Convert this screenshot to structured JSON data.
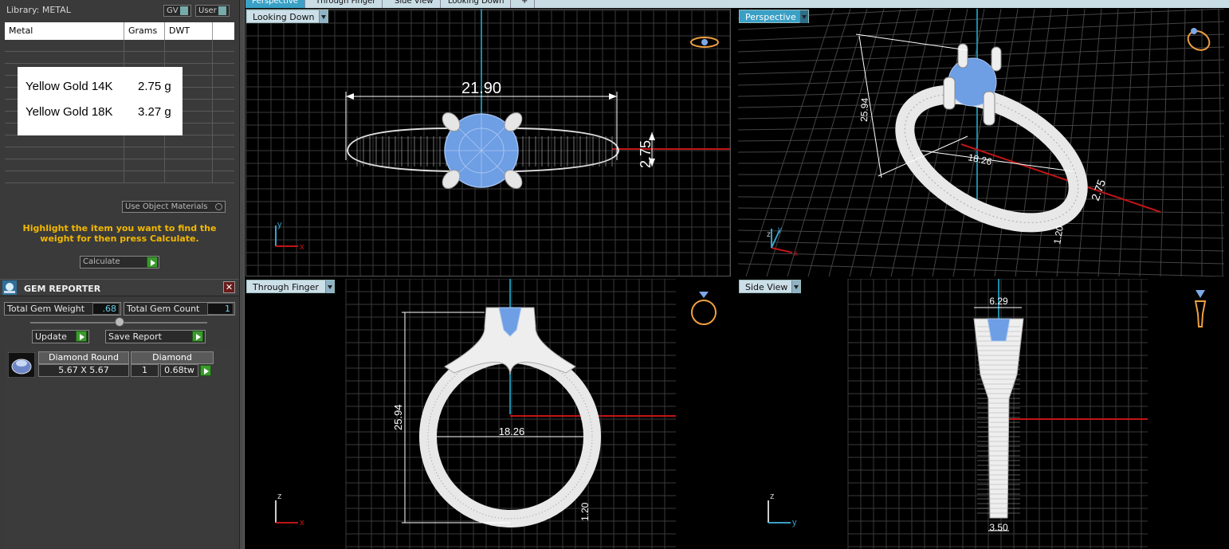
{
  "library": {
    "title": "Library: METAL",
    "gv": "GV",
    "user": "User"
  },
  "metal_table": {
    "headers": [
      "Metal",
      "Grams",
      "DWT"
    ],
    "results": [
      {
        "name": "Yellow Gold 14K",
        "weight": "2.75 g"
      },
      {
        "name": "Yellow Gold 18K",
        "weight": "3.27 g"
      }
    ]
  },
  "use_object_materials": "Use Object Materials",
  "hint": "Highlight the item you want to find the weight for then press Calculate.",
  "calculate": "Calculate",
  "gem_reporter": {
    "title": "GEM REPORTER",
    "close": "✕",
    "total_weight_label": "Total Gem Weight",
    "total_weight": ".68",
    "total_count_label": "Total Gem Count",
    "total_count": "1",
    "update": "Update",
    "save_report": "Save Report",
    "gems": [
      {
        "shape": "Diamond Round",
        "material": "Diamond",
        "size": "5.67 X 5.67",
        "count": "1",
        "weight": "0.68tw"
      }
    ]
  },
  "top_tabs": [
    "Perspective",
    "Through Finger",
    "Side View",
    "Looking Down",
    "+"
  ],
  "viewports": {
    "looking_down": {
      "tab": "Looking Down",
      "dims": {
        "width": "21.90",
        "height": "2.75"
      },
      "axes": [
        "y",
        "x"
      ]
    },
    "perspective": {
      "tab": "Perspective",
      "dims": {
        "height": "25.94",
        "inner": "18.26",
        "band": "2.75",
        "bottom": "1.20"
      },
      "axes": [
        "z",
        "y",
        "x"
      ]
    },
    "through_finger": {
      "tab": "Through Finger",
      "dims": {
        "height": "25.94",
        "inner": "18.26",
        "bottom": "1.20"
      },
      "axes": [
        "z",
        "x"
      ]
    },
    "side_view": {
      "tab": "Side View",
      "dims": {
        "top": "6.29",
        "bottom": "3.50"
      },
      "axes": [
        "z",
        "y"
      ]
    }
  },
  "colors": {
    "accent": "#3aa0c6",
    "gem": "#7ea8e8",
    "hint": "#f2b800",
    "axis_red": "#c01515",
    "axis_blue": "#1a8aa8",
    "icon": "#f0a040"
  }
}
